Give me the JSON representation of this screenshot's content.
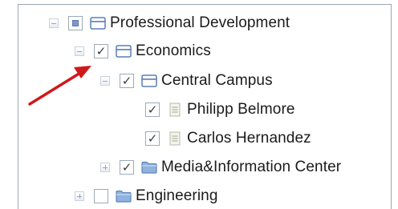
{
  "tree": {
    "items": [
      {
        "label": "Professional Development",
        "expand_state": "expanded",
        "checkbox_state": "partial",
        "node_icon": "group-folder-icon"
      },
      {
        "label": "Economics",
        "expand_state": "expanded",
        "checkbox_state": "checked",
        "node_icon": "group-folder-icon"
      },
      {
        "label": "Central Campus",
        "expand_state": "expanded",
        "checkbox_state": "checked",
        "node_icon": "group-folder-icon"
      },
      {
        "label": "Philipp Belmore",
        "expand_state": "leaf",
        "checkbox_state": "checked",
        "node_icon": "document-icon"
      },
      {
        "label": "Carlos Hernandez",
        "expand_state": "leaf",
        "checkbox_state": "checked",
        "node_icon": "document-icon"
      },
      {
        "label": "Media&Information Center",
        "expand_state": "collapsed",
        "checkbox_state": "checked",
        "node_icon": "folder-icon"
      },
      {
        "label": "Engineering",
        "expand_state": "collapsed",
        "checkbox_state": "unchecked",
        "node_icon": "folder-icon"
      }
    ]
  },
  "annotation": {
    "arrow_color": "#d0191b",
    "target": "Economics expand toggle"
  },
  "colors": {
    "panel_border": "#9aa7b3",
    "folder_blue": "#6f93c9",
    "checkbox_partial": "#7d97c8"
  }
}
